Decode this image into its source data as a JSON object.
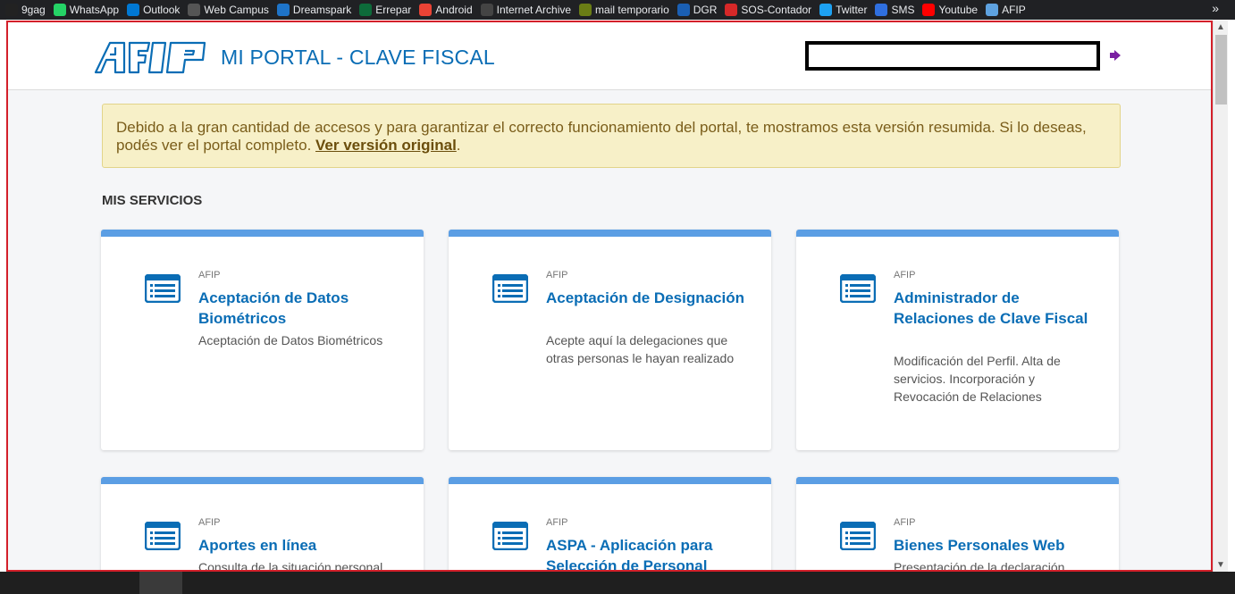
{
  "bookmarks": [
    {
      "label": "9gag",
      "icon": "9gag-icon",
      "color": "#222"
    },
    {
      "label": "WhatsApp",
      "icon": "whatsapp-icon",
      "color": "#25d366"
    },
    {
      "label": "Outlook",
      "icon": "outlook-icon",
      "color": "#0078d4"
    },
    {
      "label": "Web Campus",
      "icon": "globe-icon",
      "color": "#555"
    },
    {
      "label": "Dreamspark",
      "icon": "dreamspark-icon",
      "color": "#1e74c9"
    },
    {
      "label": "Errepar",
      "icon": "errepar-icon",
      "color": "#0d6b3a"
    },
    {
      "label": "Android",
      "icon": "google-icon",
      "color": "#ea4335"
    },
    {
      "label": "Internet Archive",
      "icon": "archive-icon",
      "color": "#444"
    },
    {
      "label": "mail temporario",
      "icon": "mail-temp-icon",
      "color": "#6a7d15"
    },
    {
      "label": "DGR",
      "icon": "dgr-icon",
      "color": "#1a5fb4"
    },
    {
      "label": "SOS-Contador",
      "icon": "lifebuoy-icon",
      "color": "#d62828"
    },
    {
      "label": "Twitter",
      "icon": "twitter-icon",
      "color": "#1da1f2"
    },
    {
      "label": "SMS",
      "icon": "sms-icon",
      "color": "#2f6fdf"
    },
    {
      "label": "Youtube",
      "icon": "youtube-icon",
      "color": "#ff0000"
    },
    {
      "label": "AFIP",
      "icon": "afip-icon",
      "color": "#5ea2e0"
    }
  ],
  "bookmarks_more": "»",
  "header": {
    "title": "MI PORTAL - CLAVE FISCAL"
  },
  "notice": {
    "text": "Debido a la gran cantidad de accesos y para garantizar el correcto funcionamiento del portal, te mostramos esta versión resumida. Si lo deseas, podés ver el portal completo. ",
    "link": "Ver versión original",
    "end": "."
  },
  "section": {
    "title": "MIS SERVICIOS"
  },
  "cards": [
    {
      "source": "AFIP",
      "title": "Aceptación de Datos Biométricos",
      "desc": "Aceptación de Datos Biométricos"
    },
    {
      "source": "AFIP",
      "title": "Aceptación de Designación",
      "desc": "Acepte aquí la delegaciones que otras personas le hayan realizado"
    },
    {
      "source": "AFIP",
      "title": "Administrador de Relaciones de Clave Fiscal",
      "desc": "Modificación del Perfil. Alta de servicios. Incorporación y Revocación de Relaciones"
    },
    {
      "source": "AFIP",
      "title": "Aportes en línea",
      "desc": "Consulta de la situación personal"
    },
    {
      "source": "AFIP",
      "title": "ASPA - Aplicación para Selección de Personal",
      "desc": ""
    },
    {
      "source": "AFIP",
      "title": "Bienes Personales Web",
      "desc": "Presentación de la declaración"
    }
  ],
  "colors": {
    "brand": "#0a6db5",
    "card_top": "#5b9ee4",
    "notice_bg": "#f7f0c8"
  }
}
